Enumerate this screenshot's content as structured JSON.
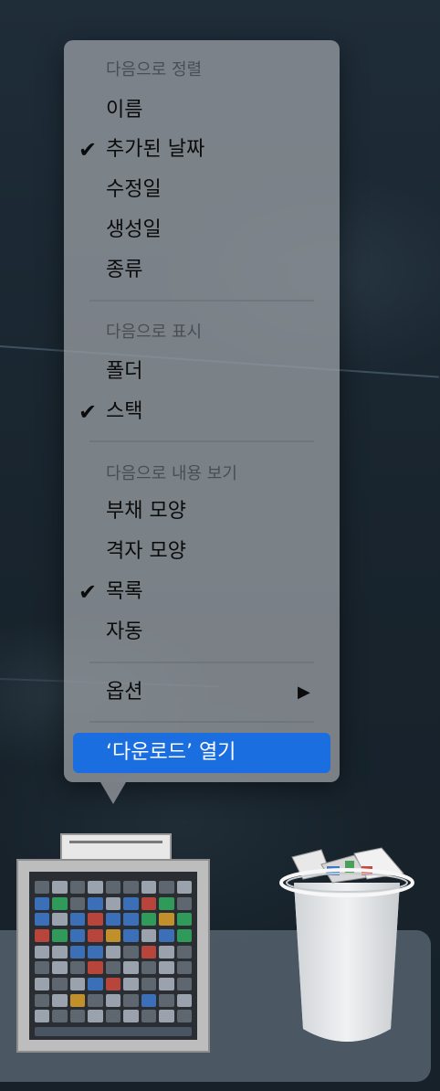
{
  "menu": {
    "sort_header": "다음으로 정렬",
    "sort_items": [
      "이름",
      "추가된 날짜",
      "수정일",
      "생성일",
      "종류"
    ],
    "display_header": "다음으로 표시",
    "display_items": [
      "폴더",
      "스택"
    ],
    "view_header": "다음으로 내용 보기",
    "view_items": [
      "부채 모양",
      "격자 모양",
      "목록",
      "자동"
    ],
    "options_label": "옵션",
    "open_label": "‘다운로드’ 열기"
  },
  "checked": [
    "추가된 날짜",
    "스택",
    "목록"
  ],
  "icons": {
    "checkmark": "checkmark-icon",
    "submenu_arrow": "triangle-right-icon",
    "stack": "downloads-stack-icon",
    "trash": "trash-icon"
  },
  "colors": {
    "highlight": "#1a6ee0",
    "menu_bg": "#969ba0"
  }
}
